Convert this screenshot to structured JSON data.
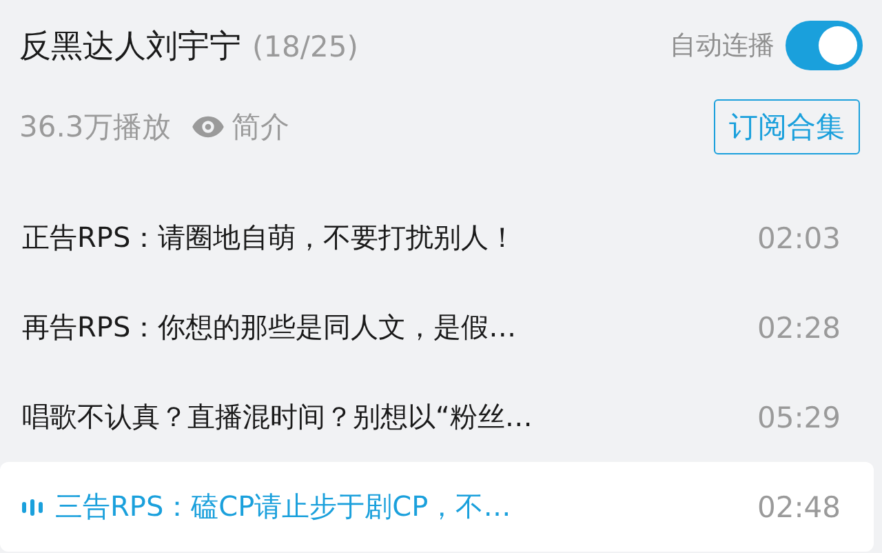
{
  "header": {
    "title": "反黑达人刘宇宁",
    "count": "(18/25)",
    "autoplay": {
      "label": "自动连播",
      "on": true
    }
  },
  "meta": {
    "plays": "36.3万播放",
    "intro": "简介",
    "subscribe": "订阅合集"
  },
  "episodes": [
    {
      "title": "正告RPS：请圈地自萌，不要打扰别人！",
      "duration": "02:03",
      "selected": false
    },
    {
      "title": "再告RPS：你想的那些是同人文，是假…",
      "duration": "02:28",
      "selected": false
    },
    {
      "title": "唱歌不认真？直播混时间？别想以“粉丝…",
      "duration": "05:29",
      "selected": false
    },
    {
      "title": "三告RPS：磕CP请止步于剧CP，不…",
      "duration": "02:48",
      "selected": true
    }
  ]
}
